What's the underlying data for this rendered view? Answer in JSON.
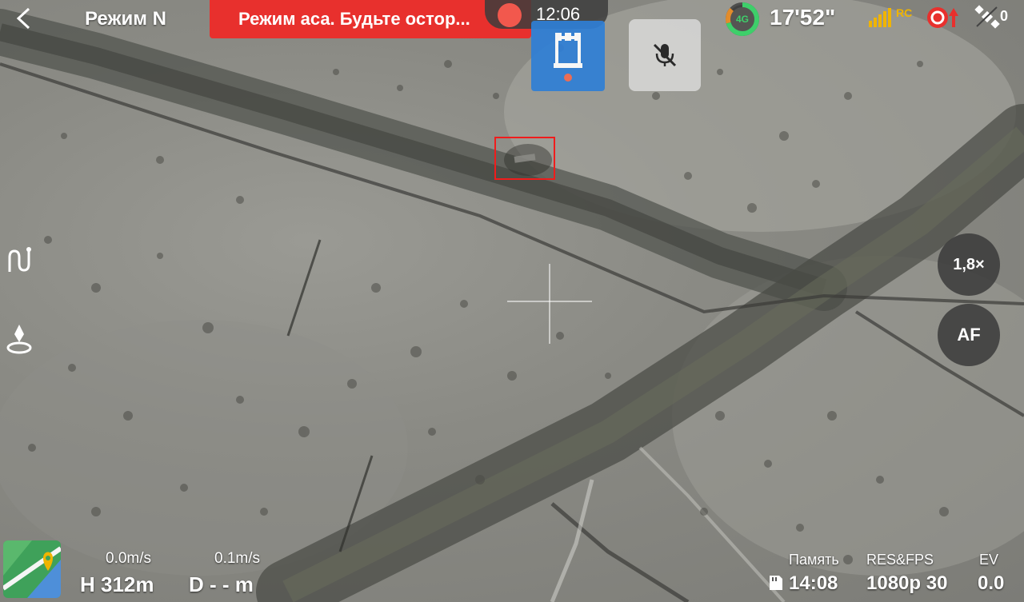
{
  "top_bar": {
    "mode": "Режим N",
    "warning": "Режим аса. Будьте остор...",
    "record_time": "12:06",
    "battery_label": "4G",
    "flight_time": "17'52\"",
    "rc_label": "RC",
    "satellite_count": "0"
  },
  "zoom": {
    "label": "1,8×"
  },
  "focus": {
    "label": "AF"
  },
  "telemetry": {
    "hspeed": "0.0m/s",
    "vspeed": "0.1m/s",
    "height": "H 312m",
    "distance": "D - - m"
  },
  "stats": {
    "memory_label": "Память",
    "memory_value": "14:08",
    "resfps_label": "RES&FPS",
    "resfps_value": "1080p 30",
    "ev_label": "EV",
    "ev_value": "0.0"
  },
  "colors": {
    "warning_bg": "#e8302d",
    "record_dot": "#f2584d",
    "tower_button": "#2f7fd6",
    "target_box": "#f01c1c",
    "battery": "#3ecf6a",
    "rc": "#f0b400"
  },
  "icons": {
    "back": "chevron-left-icon",
    "tower": "tower-icon",
    "mute": "microphone-off-icon",
    "route": "route-icon",
    "landing": "landing-icon",
    "map": "map-pin-icon",
    "sd_card": "sd-card-icon",
    "satellite": "satellite-icon",
    "alert": "alert-icon"
  }
}
